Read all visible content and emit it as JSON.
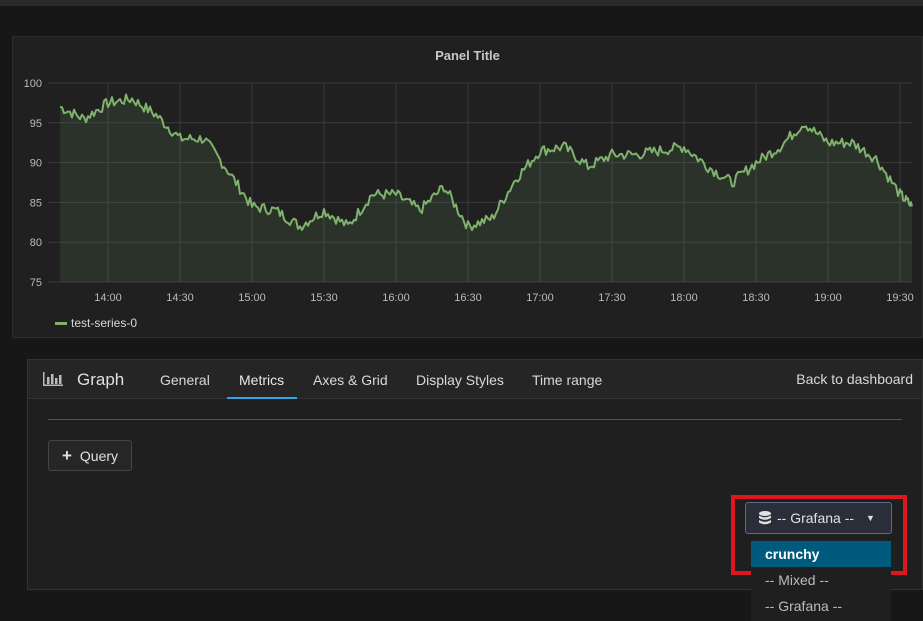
{
  "panel": {
    "title": "Panel Title",
    "legend": {
      "label": "test-series-0",
      "color": "#7eb26d"
    }
  },
  "chart_data": {
    "type": "area",
    "series": [
      {
        "name": "test-series-0",
        "color": "#7eb26d",
        "x": [
          "13:40",
          "13:50",
          "14:00",
          "14:10",
          "14:20",
          "14:30",
          "14:40",
          "14:50",
          "15:00",
          "15:10",
          "15:20",
          "15:30",
          "15:40",
          "15:50",
          "16:00",
          "16:10",
          "16:20",
          "16:30",
          "16:40",
          "16:50",
          "17:00",
          "17:10",
          "17:20",
          "17:30",
          "17:40",
          "17:50",
          "18:00",
          "18:10",
          "18:20",
          "18:30",
          "18:40",
          "18:50",
          "19:00",
          "19:10",
          "19:20",
          "19:30",
          "19:35"
        ],
        "values": [
          97,
          95.5,
          97.5,
          98,
          96,
          93,
          93,
          89,
          84.5,
          84,
          82,
          84,
          82,
          86,
          86,
          84,
          87,
          82,
          83,
          88,
          91.5,
          92,
          89.5,
          91,
          91,
          91.5,
          92,
          89.5,
          87.5,
          90,
          92,
          95,
          92.5,
          92.5,
          90.5,
          86,
          84.5
        ]
      }
    ],
    "xticks": [
      "14:00",
      "14:30",
      "15:00",
      "15:30",
      "16:00",
      "16:30",
      "17:00",
      "17:30",
      "18:00",
      "18:30",
      "19:00",
      "19:30"
    ],
    "yticks": [
      "75",
      "80",
      "85",
      "90",
      "95",
      "100"
    ],
    "ylim": [
      75,
      100
    ],
    "grid": true,
    "legend_position": "bottom-left"
  },
  "editor": {
    "title": "Graph",
    "tabs": [
      "General",
      "Metrics",
      "Axes & Grid",
      "Display Styles",
      "Time range"
    ],
    "active_tab": "Metrics",
    "back_label": "Back to dashboard",
    "query_button": "Query",
    "datasource": {
      "selected": "-- Grafana --",
      "options": [
        "crunchy",
        "-- Mixed --",
        "-- Grafana --"
      ],
      "highlighted_option": "crunchy"
    }
  },
  "colors": {
    "accent": "#33a2e5",
    "highlight": "#e0161f",
    "dropdown_active": "#005a7e"
  }
}
